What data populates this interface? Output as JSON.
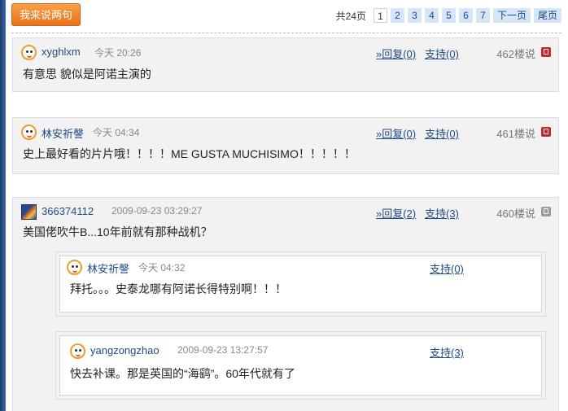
{
  "toolbar": {
    "post_label": "我来说两句"
  },
  "pager": {
    "total": "共24页",
    "pages": [
      "1",
      "2",
      "3",
      "4",
      "5",
      "6",
      "7"
    ],
    "current": "1",
    "next": "下一页",
    "last": "尾页"
  },
  "comments": [
    {
      "user": "xyghlxm",
      "time": "今天 20:26",
      "reply": "»回复(0)",
      "support": "支持(0)",
      "floor": "462楼说",
      "text": "有意思 貌似是阿诺主演的"
    },
    {
      "user": "林安祈謦",
      "time": "今天 04:34",
      "reply": "»回复(0)",
      "support": "支持(0)",
      "floor": "461楼说",
      "text": "史上最好看的片片哦！！！！ME GUSTA MUCHISIMO！！！！！"
    },
    {
      "user": "366374112",
      "time": "2009-09-23 03:29:27",
      "reply": "»回复(2)",
      "support": "支持(3)",
      "floor": "460楼说",
      "text": "美国佬吹牛B...10年前就有那种战机？",
      "replies": [
        {
          "user": "林安祈謦",
          "time": "今天 04:32",
          "support": "支持(0)",
          "text": "拜托。。。史泰龙哪有阿诺长得特别啊！！！"
        },
        {
          "user": "yangzongzhao",
          "time": "2009-09-23 13:27:57",
          "support": "支持(3)",
          "text": "快去补课。那是英国的“海鹞”。60年代就有了"
        }
      ]
    }
  ],
  "colors": {
    "accent": "#e8721a",
    "link": "#1e4b86",
    "floor_icon": "#c8282a"
  },
  "icons": {
    "avatar": "smiley-avatar-icon",
    "floor": "floor-badge-icon"
  }
}
